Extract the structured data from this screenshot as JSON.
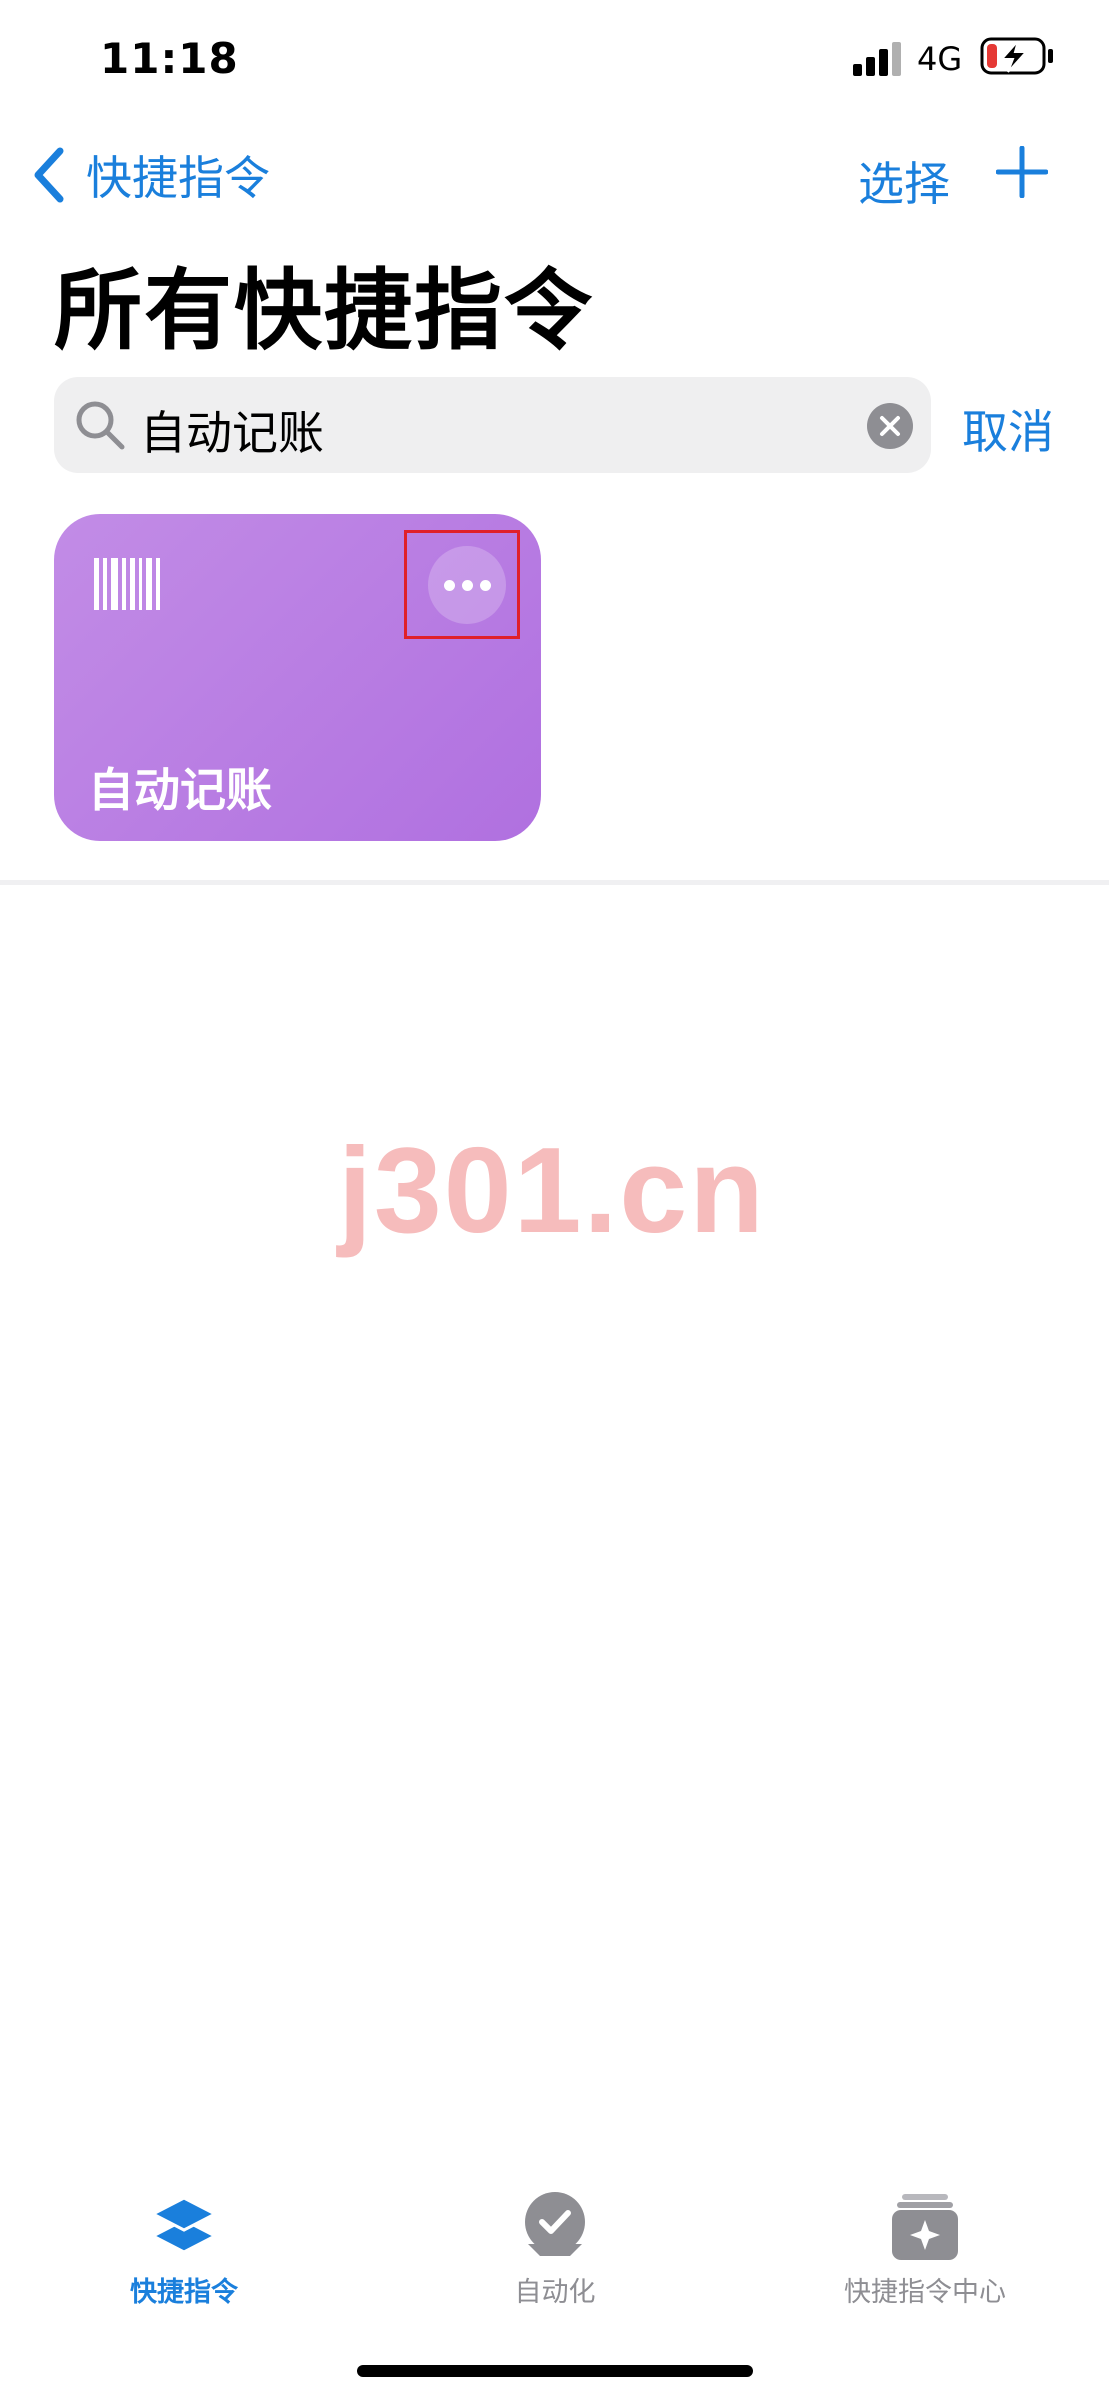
{
  "status_bar": {
    "time": "11:18",
    "network": "4G",
    "signal_icon": "cellular-signal-icon",
    "battery_icon": "battery-charging-low-icon"
  },
  "nav": {
    "back_label": "快捷指令",
    "select_label": "选择",
    "add_icon": "plus-icon"
  },
  "page_title": "所有快捷指令",
  "search": {
    "value": "自动记账",
    "cancel_label": "取消",
    "clear_icon": "clear-x-icon"
  },
  "shortcuts": [
    {
      "title": "自动记账",
      "icon": "barcode-icon",
      "more_icon": "ellipsis-icon",
      "color": "#b77ae2"
    }
  ],
  "watermark": "j301.cn",
  "tab_bar": {
    "items": [
      {
        "label": "快捷指令",
        "icon": "layers-icon",
        "active": true
      },
      {
        "label": "自动化",
        "icon": "clock-check-icon",
        "active": false
      },
      {
        "label": "快捷指令中心",
        "icon": "gallery-sparkle-icon",
        "active": false
      }
    ]
  },
  "colors": {
    "accent": "#1a7fdc",
    "card": "#b77ae2",
    "highlight": "#e0202a",
    "inactive": "#8e8e93"
  }
}
